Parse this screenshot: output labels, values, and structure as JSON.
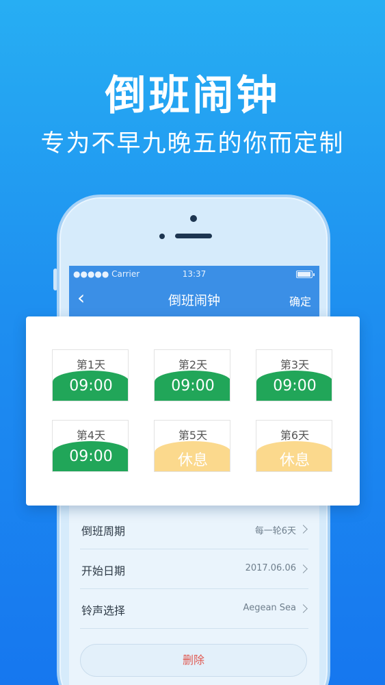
{
  "promo": {
    "title": "倒班闹钟",
    "subtitle": "专为不早九晚五的你而定制"
  },
  "status_bar": {
    "carrier": "●●●●● Carrier",
    "time": "13:37"
  },
  "nav": {
    "title": "倒班闹钟",
    "confirm_label": "确定"
  },
  "schedule": {
    "colors": {
      "work": "#21a659",
      "rest": "#fbd98d"
    },
    "days": [
      {
        "label": "第1天",
        "value": "09:00",
        "type": "work"
      },
      {
        "label": "第2天",
        "value": "09:00",
        "type": "work"
      },
      {
        "label": "第3天",
        "value": "09:00",
        "type": "work"
      },
      {
        "label": "第4天",
        "value": "09:00",
        "type": "work"
      },
      {
        "label": "第5天",
        "value": "休息",
        "type": "rest"
      },
      {
        "label": "第6天",
        "value": "休息",
        "type": "rest"
      }
    ]
  },
  "settings": [
    {
      "label": "倒班周期",
      "value": "每一轮6天"
    },
    {
      "label": "开始日期",
      "value": "2017.06.06"
    },
    {
      "label": "铃声选择",
      "value": "Aegean Sea"
    }
  ],
  "delete_label": "删除"
}
